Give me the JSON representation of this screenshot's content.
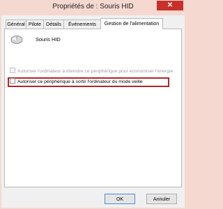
{
  "window": {
    "title": "Propriétés de : Souris HID",
    "close_label": "✕"
  },
  "tabs": [
    {
      "label": "Général"
    },
    {
      "label": "Pilote"
    },
    {
      "label": "Détails"
    },
    {
      "label": "Événements"
    },
    {
      "label": "Gestion de l'alimentation",
      "active": true
    }
  ],
  "device": {
    "name": "Souris HID",
    "icon": "mouse-icon"
  },
  "options": [
    {
      "label": "Autoriser l'ordinateur à éteindre ce périphérique pour économiser l'énergie",
      "checked": false,
      "enabled": false
    },
    {
      "label": "Autoriser ce périphérique à sortir l'ordinateur du mode veille",
      "checked": false,
      "enabled": true,
      "highlighted": true
    }
  ],
  "buttons": {
    "ok": "OK",
    "cancel": "Annuler"
  },
  "colors": {
    "titlebar": "#f5d8d0",
    "close": "#c7302b",
    "highlight_border": "#b1262b"
  }
}
